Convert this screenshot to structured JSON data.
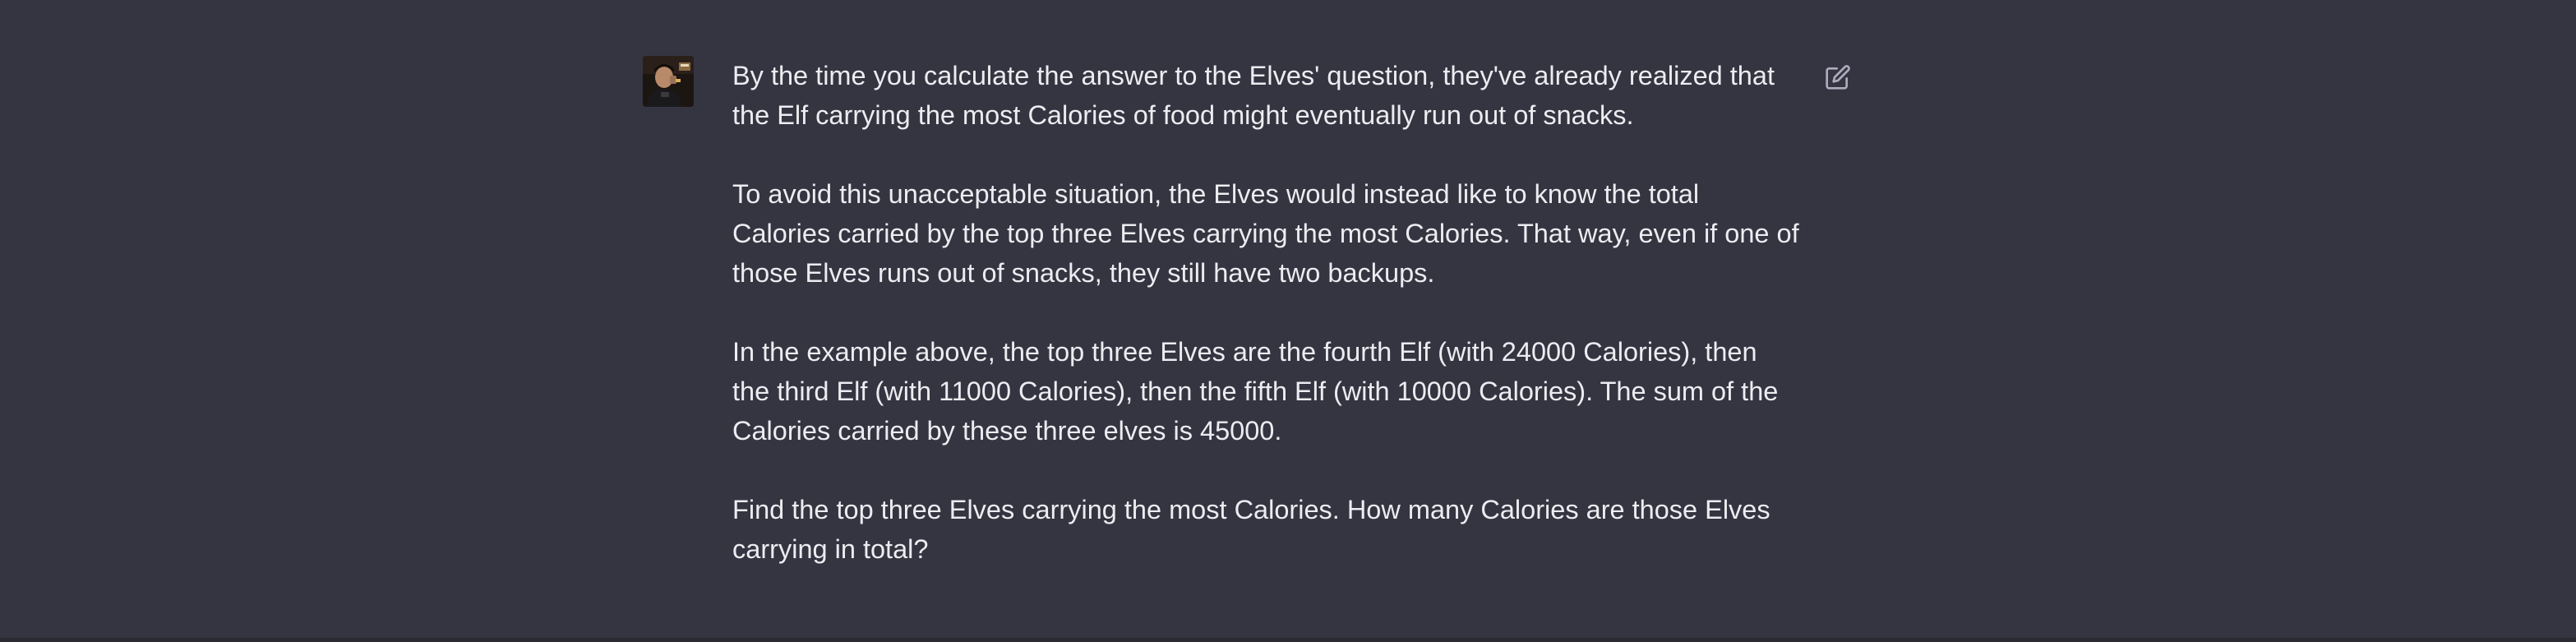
{
  "message": {
    "role": "user",
    "avatar_icon": "user-avatar-photo",
    "edit_icon": "edit-icon",
    "paragraphs": [
      "By the time you calculate the answer to the Elves' question, they've already realized that\nthe Elf carrying the most Calories of food might eventually run out of snacks.",
      "To avoid this unacceptable situation, the Elves would instead like to know the total\nCalories carried by the top three Elves carrying the most Calories. That way, even if one of\nthose Elves runs out of snacks, they still have two backups.",
      "In the example above, the top three Elves are the fourth Elf (with 24000 Calories), then\nthe third Elf (with 11000 Calories), then the fifth Elf (with 10000 Calories). The sum of the\nCalories carried by these three elves is 45000.",
      "Find the top three Elves carrying the most Calories. How many Calories are those Elves\ncarrying in total?"
    ]
  },
  "colors": {
    "background": "#343541",
    "text": "#ececf1",
    "icon": "#acacbe"
  }
}
